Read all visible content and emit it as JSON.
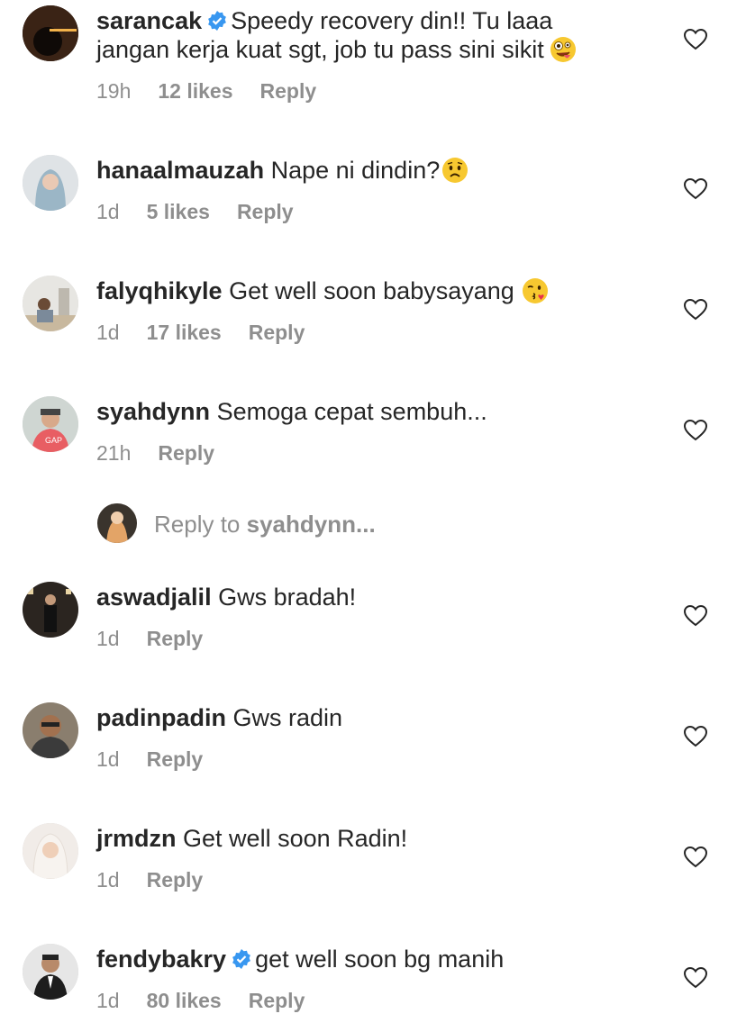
{
  "comments": [
    {
      "username": "sarancak",
      "verified": true,
      "text": "Speedy recovery din!! Tu laaa",
      "text2": "jangan kerja kuat sgt, job tu pass sini sikit",
      "emoji": "zany-face",
      "time": "19h",
      "likes": "12 likes",
      "reply": "Reply"
    },
    {
      "username": "hanaalmauzah",
      "verified": false,
      "text": "Nape ni dindin?",
      "emoji": "worried-face",
      "time": "1d",
      "likes": "5 likes",
      "reply": "Reply"
    },
    {
      "username": "falyqhikyle",
      "verified": false,
      "text": "Get well soon babysayang",
      "emoji": "kissing-heart-face",
      "time": "1d",
      "likes": "17 likes",
      "reply": "Reply"
    },
    {
      "username": "syahdynn",
      "verified": false,
      "text": "Semoga cepat sembuh...",
      "time": "21h",
      "reply": "Reply"
    },
    {
      "username": "aswadjalil",
      "verified": false,
      "text": "Gws bradah!",
      "time": "1d",
      "reply": "Reply"
    },
    {
      "username": "padinpadin",
      "verified": false,
      "text": "Gws radin",
      "time": "1d",
      "reply": "Reply"
    },
    {
      "username": "jrmdzn",
      "verified": false,
      "text": "Get well soon Radin!",
      "time": "1d",
      "reply": "Reply"
    },
    {
      "username": "fendybakry",
      "verified": true,
      "text": "get well soon bg manih",
      "time": "1d",
      "likes": "80 likes",
      "reply": "Reply"
    }
  ],
  "reply_box": {
    "prefix": "Reply to",
    "target": "syahdynn..."
  },
  "colors": {
    "text": "#262626",
    "meta": "#8e8e8e",
    "verified": "#3897f0"
  },
  "icons": {
    "like": "heart-icon",
    "verified": "verified-badge-icon"
  }
}
